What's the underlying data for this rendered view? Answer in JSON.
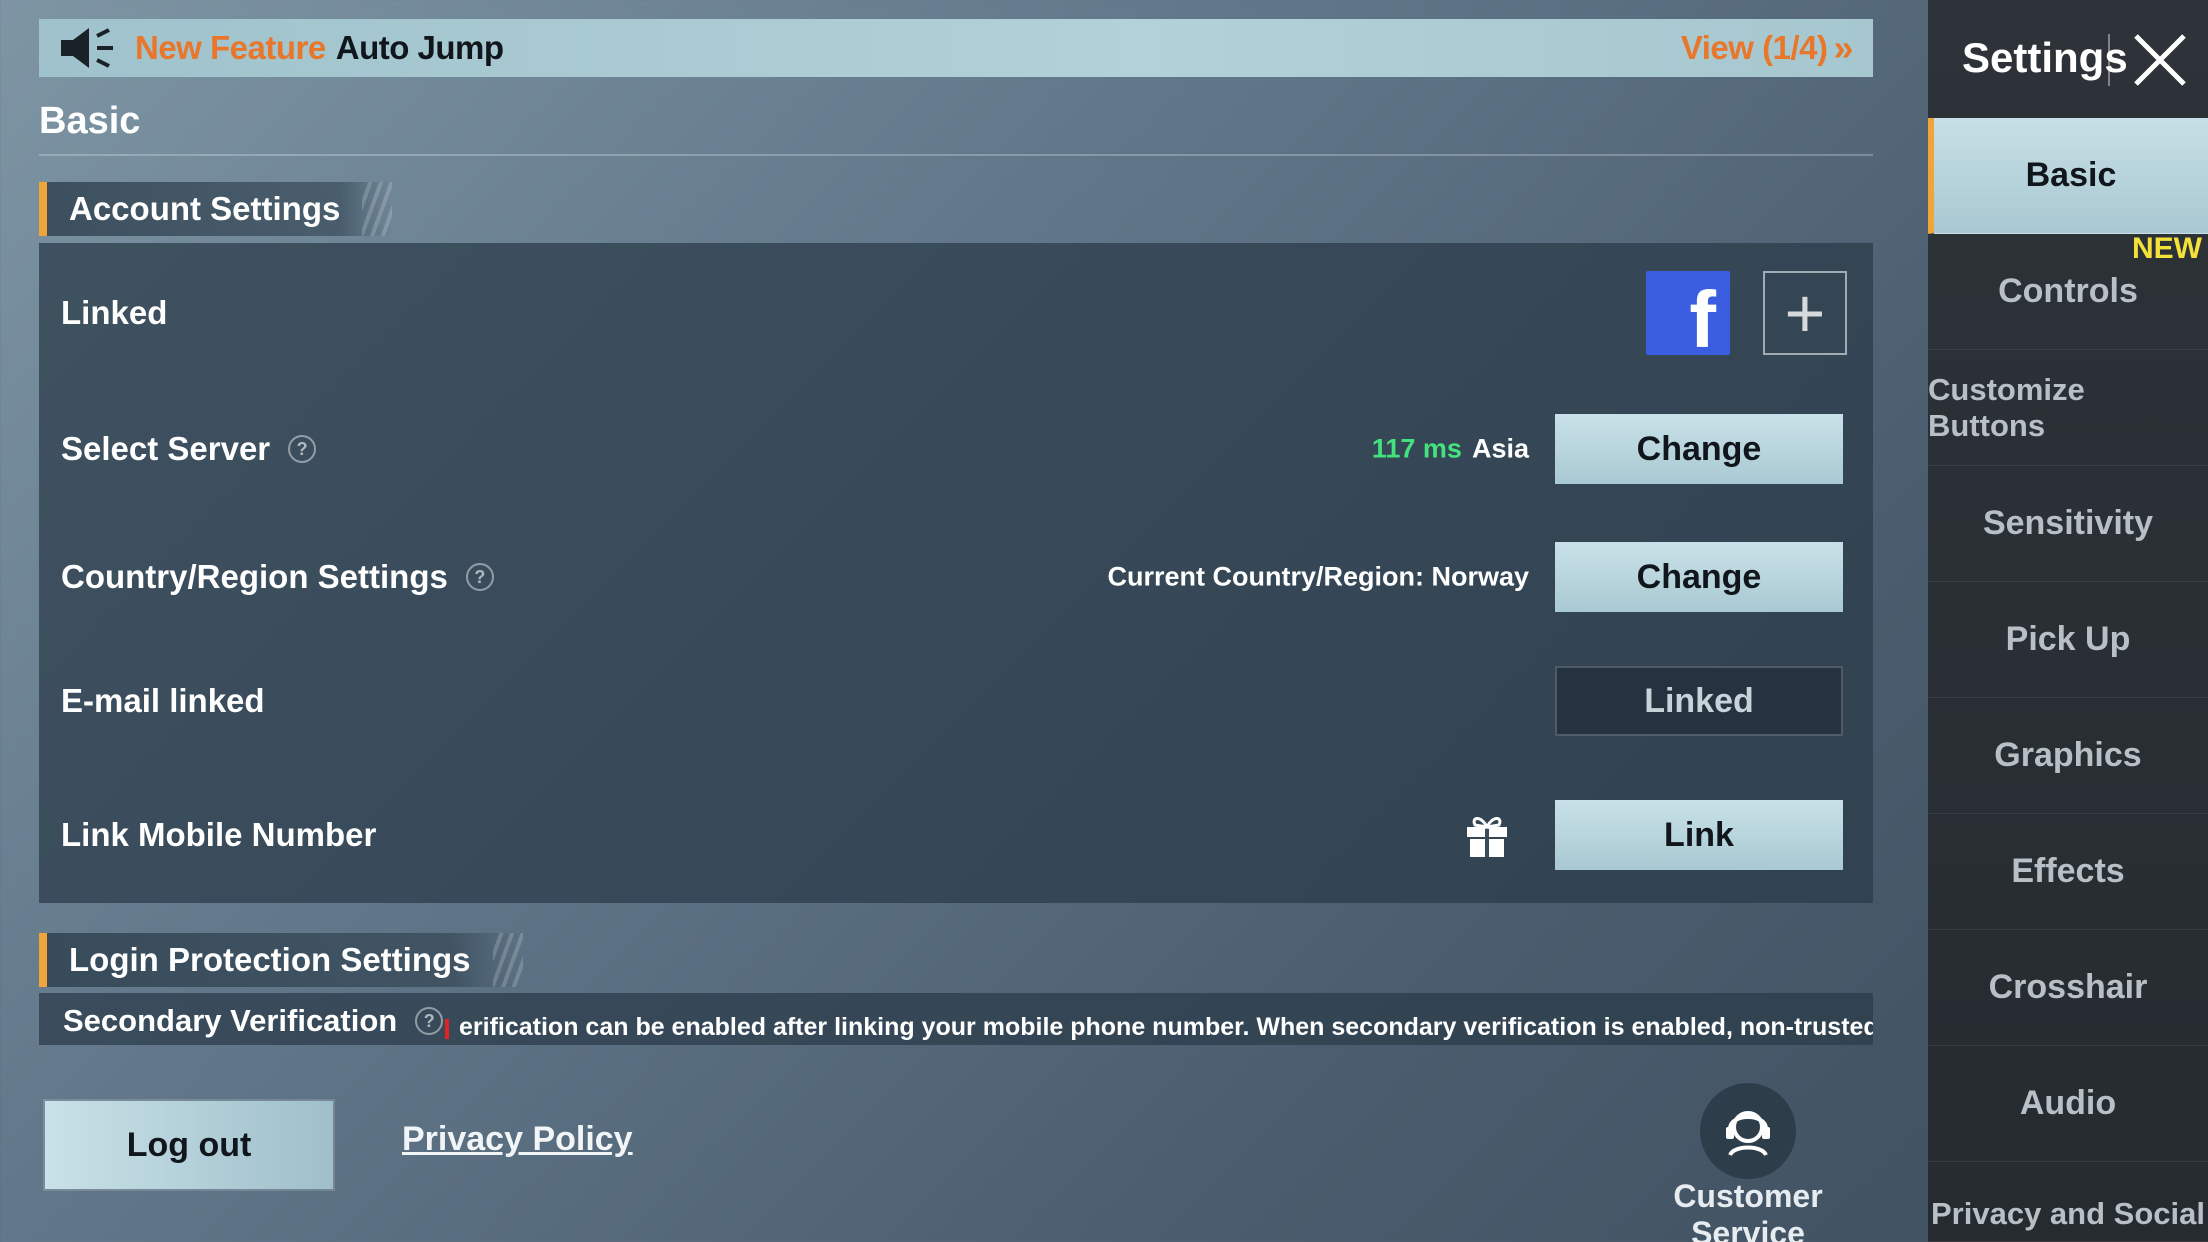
{
  "banner": {
    "highlight": "New Feature",
    "feature": "Auto Jump",
    "view": "View (1/4)",
    "view_chevron": "»"
  },
  "page": {
    "title": "Basic"
  },
  "account_settings": {
    "title": "Account Settings",
    "linked_label": "Linked",
    "linked_fb_glyph": "f",
    "plus_glyph": "+",
    "select_server_label": "Select Server",
    "ping": "117 ms",
    "server_region": "Asia",
    "change_label": "Change",
    "country_label": "Country/Region Settings",
    "country_current": "Current Country/Region: Norway",
    "email_label": "E-mail linked",
    "email_status": "Linked",
    "mobile_label": "Link Mobile Number",
    "mobile_button": "Link",
    "help_glyph": "?"
  },
  "login_protection": {
    "title": "Login Protection Settings",
    "secondary_label": "Secondary Verification",
    "secondary_desc": "erification can be enabled after linking your mobile phone number. When secondary verification is enabled, non-trusted devices are n"
  },
  "footer": {
    "logout": "Log out",
    "privacy": "Privacy Policy",
    "customer_service": "Customer Service"
  },
  "sidebar": {
    "title": "Settings",
    "new_badge": "NEW",
    "items": [
      {
        "label": "Basic"
      },
      {
        "label": "Controls"
      },
      {
        "label": "Customize Buttons"
      },
      {
        "label": "Sensitivity"
      },
      {
        "label": "Pick Up"
      },
      {
        "label": "Graphics"
      },
      {
        "label": "Effects"
      },
      {
        "label": "Crosshair"
      },
      {
        "label": "Audio"
      },
      {
        "label": "Privacy and Social"
      }
    ]
  },
  "colors": {
    "accent_orange": "#e8762b",
    "accent_bar": "#f0a53a",
    "ping_green": "#43e27d",
    "facebook_blue": "#3b5ee0",
    "new_yellow": "#f4e23a"
  }
}
